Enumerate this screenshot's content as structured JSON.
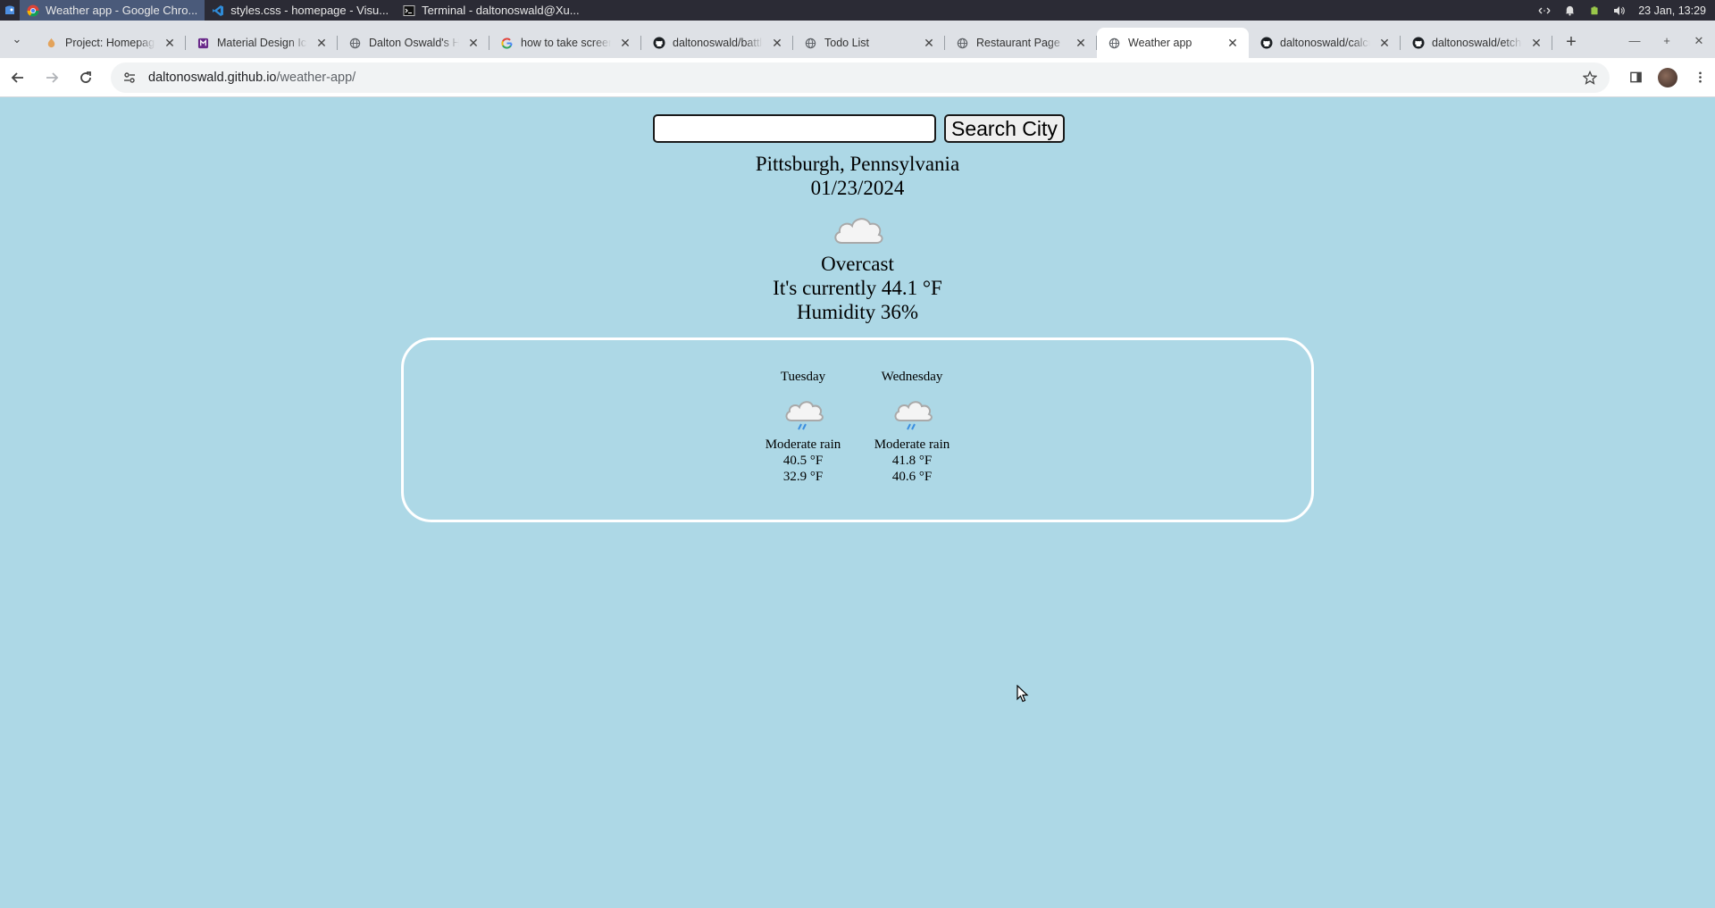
{
  "taskbar": {
    "tasks": [
      {
        "label": "Weather app - Google Chro...",
        "icon": "chrome-icon"
      },
      {
        "label": "styles.css - homepage - Visu...",
        "icon": "vscode-icon"
      },
      {
        "label": "Terminal - daltonoswald@Xu...",
        "icon": "terminal-icon"
      }
    ],
    "clock": "23 Jan, 13:29"
  },
  "browser": {
    "tabs": [
      {
        "label": "Project: Homepage",
        "icon": "odin-icon"
      },
      {
        "label": "Material Design Icons",
        "icon": "material-icon"
      },
      {
        "label": "Dalton Oswald's Homepage",
        "icon": "globe-icon"
      },
      {
        "label": "how to take screenshot",
        "icon": "google-icon"
      },
      {
        "label": "daltonoswald/battleship",
        "icon": "github-icon"
      },
      {
        "label": "Todo List",
        "icon": "globe-icon"
      },
      {
        "label": "Restaurant Page",
        "icon": "globe-icon"
      },
      {
        "label": "Weather app",
        "icon": "globe-icon",
        "active": true
      },
      {
        "label": "daltonoswald/calculator",
        "icon": "github-icon"
      },
      {
        "label": "daltonoswald/etch-a-sketch",
        "icon": "github-icon"
      }
    ],
    "url_host": "daltonoswald.github.io",
    "url_path": "/weather-app/"
  },
  "app": {
    "search": {
      "value": "",
      "placeholder": "",
      "button_label": "Search City"
    },
    "current": {
      "location": "Pittsburgh, Pennsylvania",
      "date": "01/23/2024",
      "condition": "Overcast",
      "temperature": "It's currently 44.1 °F",
      "humidity": "Humidity 36%",
      "icon": "cloud-icon"
    },
    "forecast": [
      {
        "day": "Tuesday",
        "condition": "Moderate rain",
        "high": "40.5 °F",
        "low": "32.9 °F",
        "icon": "rain-cloud-icon"
      },
      {
        "day": "Wednesday",
        "condition": "Moderate rain",
        "high": "41.8 °F",
        "low": "40.6 °F",
        "icon": "rain-cloud-icon"
      }
    ]
  },
  "colors": {
    "page_background": "#add8e6",
    "forecast_border": "#ffffff",
    "taskbar": "#2b2b35",
    "tabstrip": "#dee1e6"
  }
}
